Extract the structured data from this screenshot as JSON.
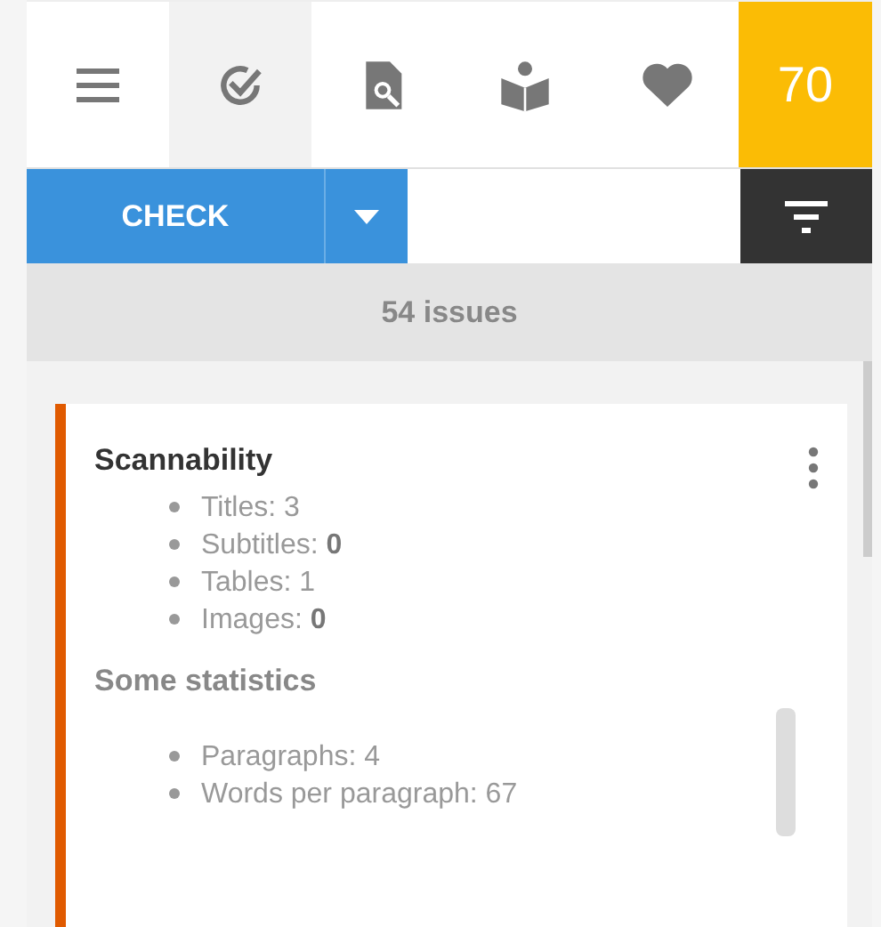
{
  "toolbar": {
    "tabs": [
      {
        "kind": "menu",
        "selected": false
      },
      {
        "kind": "check",
        "selected": true
      },
      {
        "kind": "document-search",
        "selected": false
      },
      {
        "kind": "reader",
        "selected": false
      },
      {
        "kind": "heart",
        "selected": false
      }
    ],
    "score": "70"
  },
  "actions": {
    "check_button": "CHECK"
  },
  "issues_count": "54 issues",
  "card": {
    "color": "#e05a00",
    "sections": [
      {
        "title": "Scannability",
        "muted": false,
        "items": [
          "Titles: 3",
          "Subtitles: **0**",
          "Tables: 1",
          "Images: **0**"
        ]
      },
      {
        "title": "Some statistics",
        "muted": true,
        "items": [
          "Paragraphs: 4",
          "Words per paragraph: 67"
        ]
      }
    ]
  }
}
